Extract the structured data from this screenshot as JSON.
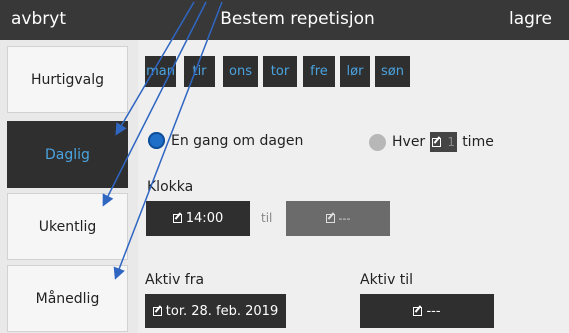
{
  "header": {
    "cancel_label": "avbryt",
    "title": "Bestem repetisjon",
    "save_label": "lagre"
  },
  "sidebar": {
    "items": [
      {
        "label": "Hurtigvalg",
        "active": false
      },
      {
        "label": "Daglig",
        "active": true
      },
      {
        "label": "Ukentlig",
        "active": false
      },
      {
        "label": "Månedlig",
        "active": false
      }
    ]
  },
  "days": [
    "man",
    "tir",
    "ons",
    "tor",
    "fre",
    "lør",
    "søn"
  ],
  "frequency": {
    "once_label": "En gang om dagen",
    "every_label": "Hver",
    "hours_value": "1",
    "hours_unit": "time",
    "selected": "once"
  },
  "time": {
    "label": "Klokka",
    "from": "14:00",
    "between": "til",
    "to": "---"
  },
  "active": {
    "from_label": "Aktiv fra",
    "from_value": "tor. 28. feb. 2019",
    "to_label": "Aktiv til",
    "to_value": "---"
  },
  "colors": {
    "header_bg": "#383838",
    "accent": "#4aa3df",
    "selected_radio": "#1f6fc9",
    "dark_button": "#2f2f2f"
  }
}
